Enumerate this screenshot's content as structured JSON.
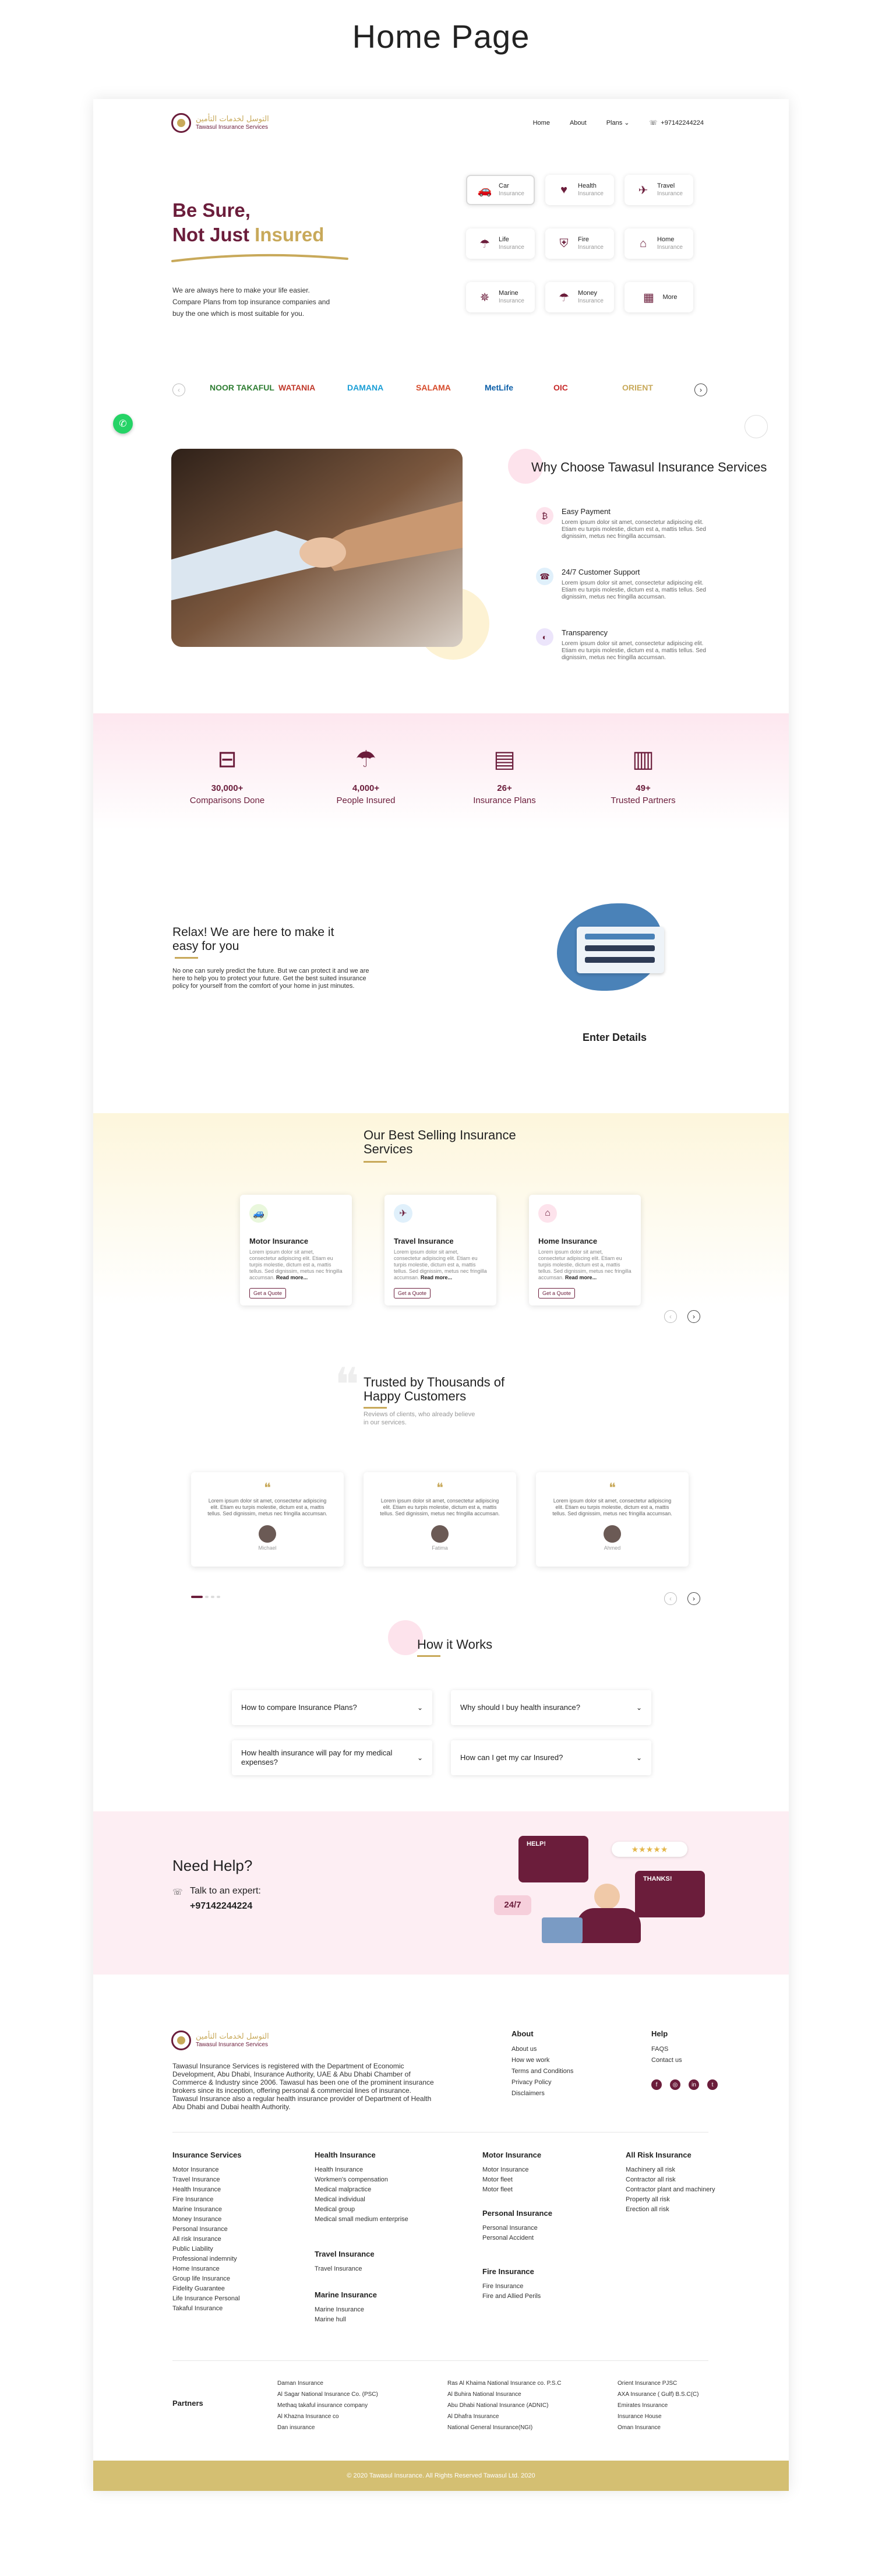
{
  "page_title": "Home Page",
  "brand": {
    "arabic": "التوسل لخدمات التأمين",
    "english": "Tawasul Insurance Services",
    "primary": "#6b1d3b",
    "gold": "#c8a95a"
  },
  "nav": {
    "home": "Home",
    "about": "About",
    "plans": "Plans",
    "phone": "+97142244224"
  },
  "hero": {
    "line1": "Be Sure,",
    "line2_a": "Not Just ",
    "line2_b": "Insured",
    "desc": "We are always here to make your life easier. Compare Plans from top insurance companies and buy the one which is most suitable for you."
  },
  "insurance_types": [
    {
      "title": "Car",
      "sub": "Insurance",
      "icon": "car-icon",
      "glyph": "🚗"
    },
    {
      "title": "Health",
      "sub": "Insurance",
      "icon": "heart-icon",
      "glyph": "♥"
    },
    {
      "title": "Travel",
      "sub": "Insurance",
      "icon": "plane-icon",
      "glyph": "✈"
    },
    {
      "title": "Life",
      "sub": "Insurance",
      "icon": "umbrella-icon",
      "glyph": "☂"
    },
    {
      "title": "Fire",
      "sub": "Insurance",
      "icon": "shield-icon",
      "glyph": "⛨"
    },
    {
      "title": "Home",
      "sub": "Insurance",
      "icon": "house-icon",
      "glyph": "⌂"
    },
    {
      "title": "Marine",
      "sub": "Insurance",
      "icon": "ship-wheel-icon",
      "glyph": "✵"
    },
    {
      "title": "Money",
      "sub": "Insurance",
      "icon": "money-umbrella-icon",
      "glyph": "☂"
    },
    {
      "title": "More",
      "sub": "",
      "icon": "grid-icon",
      "glyph": "▦"
    }
  ],
  "partners_strip": [
    "NOOR TAKAFUL",
    "WATANIA",
    "DAMANA",
    "SALAMA",
    "MetLife",
    "OIC",
    "ORIENT"
  ],
  "why": {
    "title": "Why Choose Tawasul Insurance Services",
    "items": [
      {
        "title": "Easy Payment",
        "text": "Lorem ipsum dolor sit amet, consectetur adipiscing elit. Etiam eu turpis molestie, dictum est a, mattis tellus. Sed dignissim, metus nec fringilla accumsan.",
        "icon": "wallet-icon",
        "glyph": "₿",
        "bg": "#fde3ec"
      },
      {
        "title": "24/7 Customer Support",
        "text": "Lorem ipsum dolor sit amet, consectetur adipiscing elit. Etiam eu turpis molestie, dictum est a, mattis tellus. Sed dignissim, metus nec fringilla accumsan.",
        "icon": "headset-icon",
        "glyph": "☎",
        "bg": "#e0f0fb"
      },
      {
        "title": "Transparency",
        "text": "Lorem ipsum dolor sit amet, consectetur adipiscing elit. Etiam eu turpis molestie, dictum est a, mattis tellus. Sed dignissim, metus nec fringilla accumsan.",
        "icon": "transparency-icon",
        "glyph": "◐",
        "bg": "#ece5fb"
      }
    ]
  },
  "stats": [
    {
      "num": "30,000+",
      "label": "Comparisons Done",
      "icon": "compare-icon",
      "glyph": "⊟"
    },
    {
      "num": "4,000+",
      "label": "People Insured",
      "icon": "people-umbrella-icon",
      "glyph": "☂"
    },
    {
      "num": "26+",
      "label": "Insurance Plans",
      "icon": "plan-document-icon",
      "glyph": "▤"
    },
    {
      "num": "49+",
      "label": "Trusted Partners",
      "icon": "building-icon",
      "glyph": "▥"
    }
  ],
  "relax": {
    "title": "Relax! We are here to make it easy for you",
    "text": "No one can surely predict the future. But we can protect it and we are here to help you to protect your future. Get the best suited insurance policy for yourself from the comfort of your home in just minutes.",
    "step": "Enter Details"
  },
  "best": {
    "title": "Our Best Selling Insurance Services",
    "products": [
      {
        "title": "Motor Insurance",
        "text": "Lorem ipsum dolor sit amet, consectetur adipiscing elit. Etiam eu turpis molestie, dictum est a, mattis tellus. Sed dignissim, metus nec fringilla accumsan.",
        "more": "Read more...",
        "btn": "Get a Quote",
        "icon": "car-icon",
        "glyph": "🚙",
        "bg": "#e9f7dc"
      },
      {
        "title": "Travel Insurance",
        "text": "Lorem ipsum dolor sit amet, consectetur adipiscing elit. Etiam eu turpis molestie, dictum est a, mattis tellus. Sed dignissim, metus nec fringilla accumsan.",
        "more": "Read more...",
        "btn": "Get a Quote",
        "icon": "plane-icon",
        "glyph": "✈",
        "bg": "#e0f0fb"
      },
      {
        "title": "Home Insurance",
        "text": "Lorem ipsum dolor sit amet, consectetur adipiscing elit. Etiam eu turpis molestie, dictum est a, mattis tellus. Sed dignissim, metus nec fringilla accumsan.",
        "more": "Read more...",
        "btn": "Get a Quote",
        "icon": "house-icon",
        "glyph": "⌂",
        "bg": "#fde3ec"
      }
    ]
  },
  "trust": {
    "title": "Trusted by Thousands of Happy Customers",
    "sub": "Reviews of clients, who already believe in our services.",
    "reviews": [
      {
        "text": "Lorem ipsum dolor sit amet, consectetur adipiscing elit. Etiam eu turpis molestie, dictum est a, mattis tellus. Sed dignissim, metus nec fringilla accumsan.",
        "name": "Michael"
      },
      {
        "text": "Lorem ipsum dolor sit amet, consectetur adipiscing elit. Etiam eu turpis molestie, dictum est a, mattis tellus. Sed dignissim, metus nec fringilla accumsan.",
        "name": "Fatima"
      },
      {
        "text": "Lorem ipsum dolor sit amet, consectetur adipiscing elit. Etiam eu turpis molestie, dictum est a, mattis tellus. Sed dignissim, metus nec fringilla accumsan.",
        "name": "Ahmed"
      }
    ]
  },
  "how": {
    "title": "How it Works",
    "faqs": [
      "How to compare Insurance Plans?",
      "Why should I buy health insurance?",
      "How health insurance will pay for my medical expenses?",
      "How can I get my car Insured?"
    ]
  },
  "help": {
    "title": "Need Help?",
    "talk": "Talk to an expert:",
    "phone": "+97142244224",
    "badge": "24/7",
    "bubble1": "HELP!",
    "bubble2": "THANKS!"
  },
  "footer": {
    "about_text": "Tawasul Insurance Services is registered with the Department of Economic Development, Abu Dhabi, Insurance Authority, UAE & Abu Dhabi Chamber of Commerce & Industry since 2006. Tawasul has been one of the prominent insurance brokers since its inception, offering personal & commercial lines of insurance. Tawasul Insurance also a regular health insurance provider of Department of Health Abu Dhabi and Dubai health Authority.",
    "about": {
      "title": "About",
      "links": [
        "About us",
        "How we work",
        "Terms and Conditions",
        "Privacy Policy",
        "Disclaimers"
      ]
    },
    "help": {
      "title": "Help",
      "links": [
        "FAQS",
        "Contact us"
      ]
    },
    "cols": [
      {
        "title": "Insurance Services",
        "links": [
          "Motor Insurance",
          "Travel Insurance",
          "Health Insurance",
          "Fire Insurance",
          "Marine Insurance",
          "Money Insurance",
          "Personal Insurance",
          "All risk Insurance",
          "Public Liability",
          "Professional indemnity",
          "Home Insurance",
          "Group life Insurance",
          "Fidelity Guarantee",
          "Life Insurance Personal",
          "Takaful Insurance"
        ]
      },
      {
        "title": "Health Insurance",
        "links": [
          "Health Insurance",
          "Workmen's compensation",
          "Medical malpractice",
          "Medical individual",
          "Medical group",
          "Medical small medium enterprise"
        ]
      },
      {
        "title": "Travel Insurance",
        "links": [
          "Travel Insurance"
        ]
      },
      {
        "title": "Marine Insurance",
        "links": [
          "Marine Insurance",
          "Marine hull"
        ]
      },
      {
        "title": "Motor Insurance",
        "links": [
          "Motor Insurance",
          "Motor fleet",
          "Motor fleet"
        ]
      },
      {
        "title": "Personal Insurance",
        "links": [
          "Personal Insurance",
          "Personal Accident"
        ]
      },
      {
        "title": "Fire Insurance",
        "links": [
          "Fire Insurance",
          "Fire and Allied Perils"
        ]
      },
      {
        "title": "All Risk Insurance",
        "links": [
          "Machinery all risk",
          "Contractor all risk",
          "Contractor plant and machinery",
          "Property all risk",
          "Erection all risk"
        ]
      }
    ],
    "partners_label": "Partners",
    "partners": [
      [
        "Daman Insurance",
        "Al Sagar National Insurance Co. (PSC)",
        "Methaq takaful insurance company",
        "Al Khazna Insurance co",
        "Dan insurance"
      ],
      [
        "Ras Al Khaima National Insurance co. P.S.C",
        "Al Buhira National Insurance",
        "Abu Dhabi National Insurance (ADNIC)",
        "Al Dhafra Insurance",
        "National General Insurance(NGI)"
      ],
      [
        "Orient Insurance PJSC",
        "AXA Insurance ( Gulf) B.S.C(C)",
        "Emirates Insurance",
        "Insurance House",
        "Oman Insurance"
      ]
    ],
    "copyright": "© 2020 Tawasul Insurance. All Rights Reserved Tawasul Ltd. 2020"
  }
}
